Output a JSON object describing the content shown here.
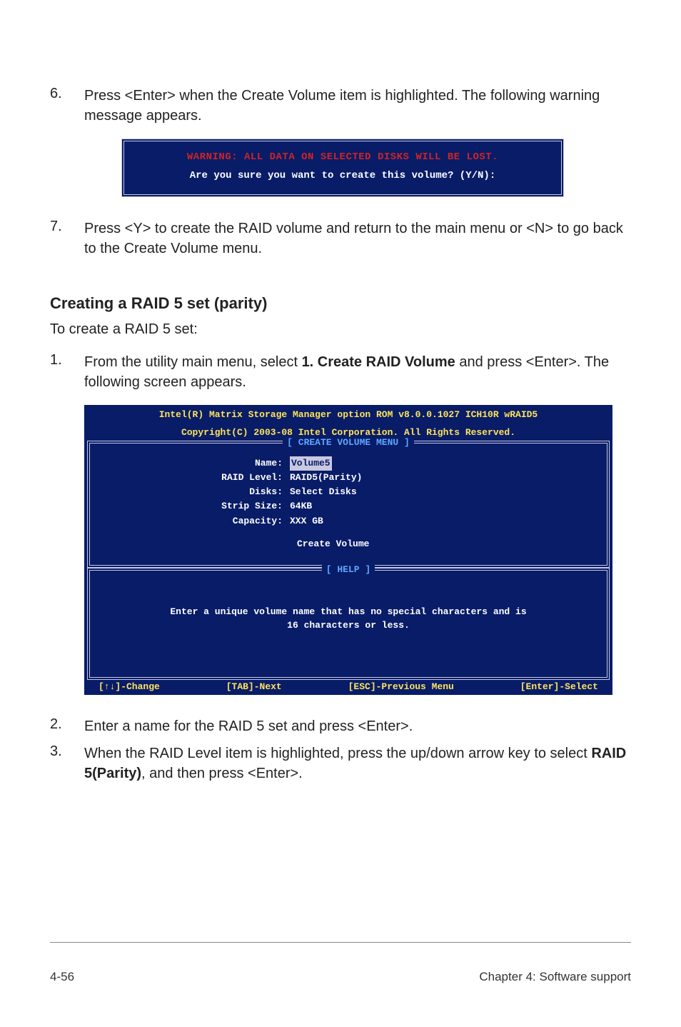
{
  "step6": {
    "num": "6.",
    "text": "Press <Enter> when the Create Volume item is highlighted. The following warning message appears."
  },
  "warn": {
    "line1": "WARNING: ALL DATA ON SELECTED DISKS WILL BE LOST.",
    "line2": "Are you sure you want to create this volume? (Y/N):"
  },
  "step7": {
    "num": "7.",
    "text": "Press <Y> to create the RAID volume and return to the main menu or <N> to go back to the Create Volume menu."
  },
  "section_title": "Creating a RAID 5 set (parity)",
  "lead": "To create a RAID 5 set:",
  "step1": {
    "num": "1.",
    "text_a": "From the utility main menu, select ",
    "text_b": "1. Create RAID Volume",
    "text_c": " and press <Enter>. The following screen appears."
  },
  "bios": {
    "hdr1": "Intel(R) Matrix Storage Manager option ROM v8.0.0.1027 ICH10R wRAID5",
    "hdr2": "Copyright(C) 2003-08 Intel Corporation. All Rights Reserved.",
    "panel1_title": "[ CREATE VOLUME MENU ]",
    "fields": {
      "name_k": "Name:",
      "name_v": "Volume5",
      "raid_k": "RAID Level:",
      "raid_v": "RAID5(Parity)",
      "disks_k": "Disks:",
      "disks_v": "Select Disks",
      "strip_k": "Strip Size:",
      "strip_v": "64KB",
      "cap_k": "Capacity:",
      "cap_v": "XXX   GB"
    },
    "action": "Create Volume",
    "panel2_title": "[ HELP ]",
    "help_text": "Enter a unique volume name that has no special characters and is\n16 characters or less.",
    "footer": {
      "a": "[↑↓]-Change",
      "b": "[TAB]-Next",
      "c": "[ESC]-Previous Menu",
      "d": "[Enter]-Select"
    }
  },
  "step2": {
    "num": "2.",
    "text": "Enter a name for the RAID 5 set and press <Enter>."
  },
  "step3": {
    "num": "3.",
    "text_a": "When the RAID Level item is highlighted, press the up/down arrow key to select ",
    "text_b": "RAID 5(Parity)",
    "text_c": ", and then press <Enter>."
  },
  "footer": {
    "left": "4-56",
    "right": "Chapter 4: Software support"
  }
}
